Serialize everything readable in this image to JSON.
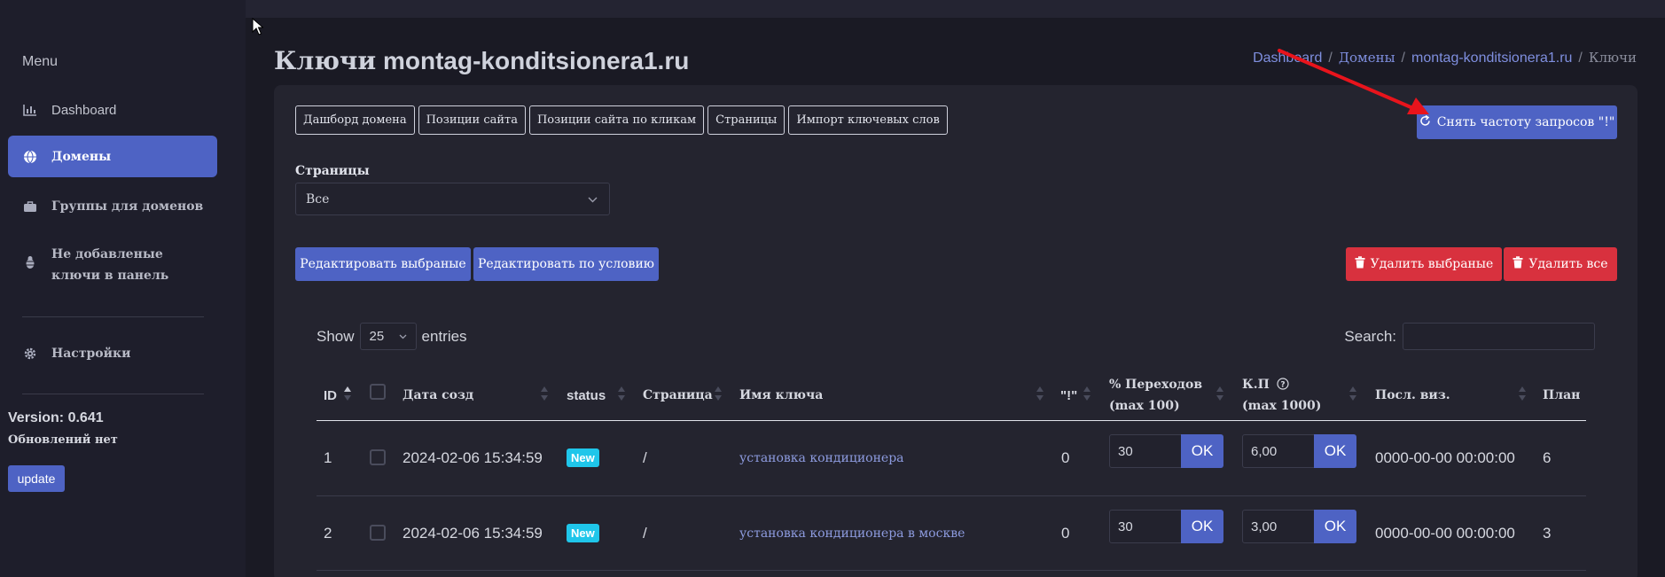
{
  "sidebar": {
    "menu_title": "Menu",
    "items": [
      {
        "label": "Dashboard",
        "icon": "chart-bar-icon"
      },
      {
        "label": "Домены",
        "icon": "globe-icon"
      },
      {
        "label": "Группы для доменов",
        "icon": "briefcase-icon"
      },
      {
        "label": "Не добавленые ключи в панель",
        "icon": "bug-icon"
      }
    ],
    "settings_label": "Настройки",
    "version": "Version: 0.641",
    "update_status": "Обновлений нет",
    "update_button": "update"
  },
  "header": {
    "title_prefix": "Ключи",
    "title_domain": "montag-konditsionera1.ru",
    "breadcrumb": [
      "Dashboard",
      "Домены",
      "montag-konditsionera1.ru",
      "Ключи"
    ]
  },
  "tabs": [
    "Дашборд домена",
    "Позиции сайта",
    "Позиции сайта по кликам",
    "Страницы",
    "Импорт ключевых слов"
  ],
  "actions": {
    "freq_button": "Снять частоту запросов \"!\"",
    "edit_selected": "Редактировать выбраные",
    "edit_by_condition": "Редактировать по условию",
    "delete_selected": "Удалить выбраные",
    "delete_all": "Удалить все"
  },
  "filter": {
    "pages_label": "Страницы",
    "pages_value": "Все"
  },
  "table_controls": {
    "show_label": "Show",
    "entries_value": "25",
    "entries_label": "entries",
    "search_label": "Search:"
  },
  "table": {
    "headers": {
      "id": "ID",
      "date": "Дата созд",
      "status": "status",
      "page": "Страница",
      "key": "Имя ключа",
      "excl": "\"!\"",
      "transitions_1": "% Переходов",
      "transitions_2": "(max 100)",
      "kp_1": "К.П",
      "kp_2": "(max 1000)",
      "last_visit": "Посл. виз.",
      "plan": "План"
    },
    "ok_label": "OK",
    "rows": [
      {
        "id": "1",
        "date": "2024-02-06 15:34:59",
        "status": "New",
        "page": "/",
        "key": "установка кондиционера",
        "excl": "0",
        "transitions": "30",
        "kp": "6,00",
        "last_visit": "0000-00-00 00:00:00",
        "plan": "6"
      },
      {
        "id": "2",
        "date": "2024-02-06 15:34:59",
        "status": "New",
        "page": "/",
        "key": "установка кондиционера в москве",
        "excl": "0",
        "transitions": "30",
        "kp": "3,00",
        "last_visit": "0000-00-00 00:00:00",
        "plan": "3"
      }
    ]
  },
  "colors": {
    "accent": "#4e63c4",
    "danger": "#d8313e",
    "badge": "#1fc6ea",
    "annotation_arrow": "#e8141c"
  }
}
